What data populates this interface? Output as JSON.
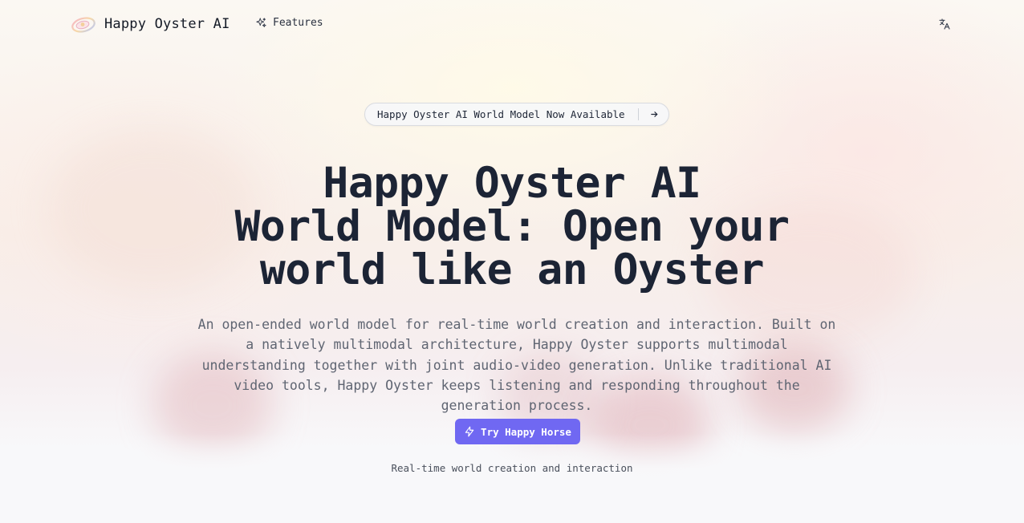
{
  "header": {
    "brand_name": "Happy Oyster AI",
    "nav": [
      {
        "label": "Features",
        "icon": "sparkles-icon"
      }
    ],
    "language_icon": "translate-icon"
  },
  "announcement": {
    "text": "Happy Oyster AI World Model Now Available",
    "icon": "arrow-right-icon"
  },
  "hero": {
    "title_lines": [
      "Happy Oyster AI",
      "World Model: Open your",
      "world like an Oyster"
    ],
    "description": "An open-ended world model for real-time world creation and interaction. Built on a natively multimodal architecture, Happy Oyster supports multimodal understanding together with joint audio-video generation. Unlike traditional AI video tools, Happy Oyster keeps listening and responding throughout the generation process.",
    "cta_label": "Try Happy Horse",
    "cta_icon": "lightning-icon",
    "tagline": "Real-time world creation and interaction"
  },
  "colors": {
    "accent": "#7068f2",
    "title": "#1c2435",
    "body_text": "#5f6572"
  }
}
